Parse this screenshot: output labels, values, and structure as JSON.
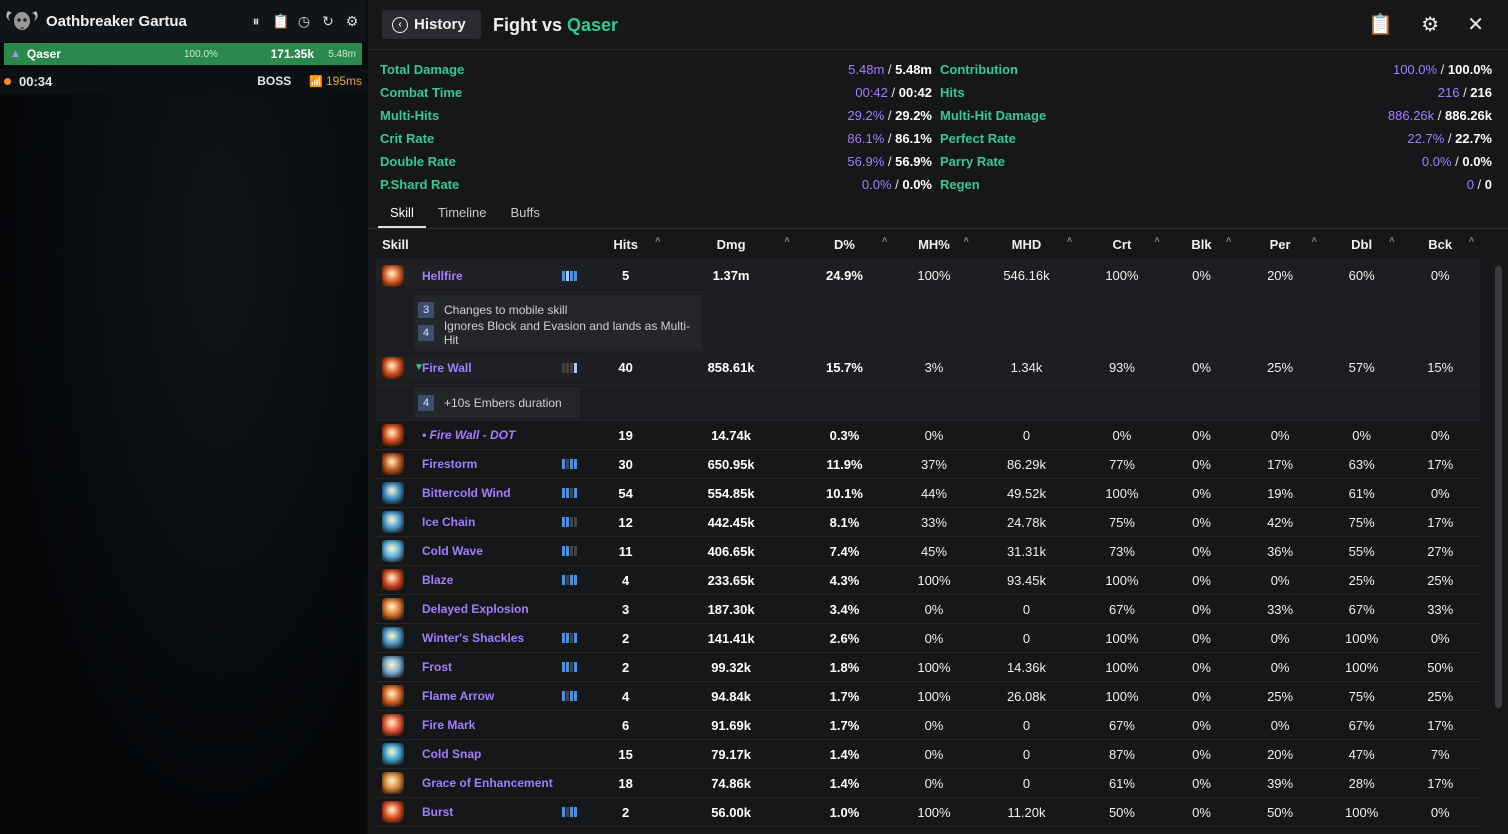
{
  "overlay": {
    "title": "Oathbreaker Gartua",
    "player": {
      "name": "Qaser",
      "pct": "100.0%",
      "damage": "171.35k",
      "total": "5.48m"
    },
    "timer": "00:34",
    "boss_label": "BOSS",
    "ping": "195ms"
  },
  "header": {
    "history_label": "History",
    "fight_prefix": "Fight vs ",
    "opponent": "Qaser"
  },
  "stats": [
    {
      "l_label": "Total Damage",
      "l_a": "5.48m",
      "l_b": "5.48m",
      "r_label": "Contribution",
      "r_a": "100.0%",
      "r_b": "100.0%"
    },
    {
      "l_label": "Combat Time",
      "l_a": "00:42",
      "l_b": "00:42",
      "r_label": "Hits",
      "r_a": "216",
      "r_b": "216"
    },
    {
      "l_label": "Multi-Hits",
      "l_a": "29.2%",
      "l_b": "29.2%",
      "r_label": "Multi-Hit Damage",
      "r_a": "886.26k",
      "r_b": "886.26k"
    },
    {
      "l_label": "Crit Rate",
      "l_a": "86.1%",
      "l_b": "86.1%",
      "r_label": "Perfect Rate",
      "r_a": "22.7%",
      "r_b": "22.7%"
    },
    {
      "l_label": "Double Rate",
      "l_a": "56.9%",
      "l_b": "56.9%",
      "r_label": "Parry Rate",
      "r_a": "0.0%",
      "r_b": "0.0%"
    },
    {
      "l_label": "P.Shard Rate",
      "l_a": "0.0%",
      "l_b": "0.0%",
      "r_label": "Regen",
      "r_a": "0",
      "r_b": "0"
    }
  ],
  "tabs": [
    "Skill",
    "Timeline",
    "Buffs"
  ],
  "columns": [
    "Skill",
    "Hits",
    "Dmg",
    "D%",
    "MH%",
    "MHD",
    "Crt",
    "Blk",
    "Per",
    "Dbl",
    "Bck"
  ],
  "rows": [
    {
      "name": "Hellfire",
      "hits": "5",
      "dmg": "1.37m",
      "dp": "24.9%",
      "mhp": "100%",
      "mhd": "546.16k",
      "crt": "100%",
      "blk": "0%",
      "per": "20%",
      "dbl": "60%",
      "bck": "0%",
      "bars": [
        1,
        2,
        1,
        1
      ],
      "color": "#e0602a",
      "traits": [
        {
          "n": "3",
          "text": "Changes to mobile skill"
        },
        {
          "n": "4",
          "text": "Ignores Block and Evasion and lands as Multi-Hit"
        }
      ]
    },
    {
      "name": "Fire Wall",
      "hits": "40",
      "dmg": "858.61k",
      "dp": "15.7%",
      "mhp": "3%",
      "mhd": "1.34k",
      "crt": "93%",
      "blk": "0%",
      "per": "25%",
      "dbl": "57%",
      "bck": "15%",
      "bars": [
        0,
        0,
        0,
        2
      ],
      "color": "#d8501e",
      "expanded": true,
      "traits": [
        {
          "n": "4",
          "text": "+10s Embers duration"
        }
      ]
    },
    {
      "name": "• Fire Wall - DOT",
      "sub": true,
      "hits": "19",
      "dmg": "14.74k",
      "dp": "0.3%",
      "mhp": "0%",
      "mhd": "0",
      "crt": "0%",
      "blk": "0%",
      "per": "0%",
      "dbl": "0%",
      "bck": "0%",
      "bars": [],
      "color": "#d8501e"
    },
    {
      "name": "Firestorm",
      "hits": "30",
      "dmg": "650.95k",
      "dp": "11.9%",
      "mhp": "37%",
      "mhd": "86.29k",
      "crt": "77%",
      "blk": "0%",
      "per": "17%",
      "dbl": "63%",
      "bck": "17%",
      "bars": [
        1,
        0,
        1,
        1
      ],
      "color": "#c45a22"
    },
    {
      "name": "Bittercold Wind",
      "hits": "54",
      "dmg": "554.85k",
      "dp": "10.1%",
      "mhp": "44%",
      "mhd": "49.52k",
      "crt": "100%",
      "blk": "0%",
      "per": "19%",
      "dbl": "61%",
      "bck": "0%",
      "bars": [
        1,
        1,
        0,
        1
      ],
      "color": "#3a8fc8"
    },
    {
      "name": "Ice Chain",
      "hits": "12",
      "dmg": "442.45k",
      "dp": "8.1%",
      "mhp": "33%",
      "mhd": "24.78k",
      "crt": "75%",
      "blk": "0%",
      "per": "42%",
      "dbl": "75%",
      "bck": "17%",
      "bars": [
        1,
        1,
        0,
        0
      ],
      "color": "#4aa0d8"
    },
    {
      "name": "Cold Wave",
      "hits": "11",
      "dmg": "406.65k",
      "dp": "7.4%",
      "mhp": "45%",
      "mhd": "31.31k",
      "crt": "73%",
      "blk": "0%",
      "per": "36%",
      "dbl": "55%",
      "bck": "27%",
      "bars": [
        1,
        1,
        0,
        0
      ],
      "color": "#5ab4e0"
    },
    {
      "name": "Blaze",
      "hits": "4",
      "dmg": "233.65k",
      "dp": "4.3%",
      "mhp": "100%",
      "mhd": "93.45k",
      "crt": "100%",
      "blk": "0%",
      "per": "0%",
      "dbl": "25%",
      "bck": "25%",
      "bars": [
        1,
        0,
        1,
        1
      ],
      "color": "#d44a26"
    },
    {
      "name": "Delayed Explosion",
      "hits": "3",
      "dmg": "187.30k",
      "dp": "3.4%",
      "mhp": "0%",
      "mhd": "0",
      "crt": "67%",
      "blk": "0%",
      "per": "33%",
      "dbl": "67%",
      "bck": "33%",
      "bars": [],
      "color": "#e07a30"
    },
    {
      "name": "Winter's Shackles",
      "hits": "2",
      "dmg": "141.41k",
      "dp": "2.6%",
      "mhp": "0%",
      "mhd": "0",
      "crt": "100%",
      "blk": "0%",
      "per": "0%",
      "dbl": "100%",
      "bck": "0%",
      "bars": [
        1,
        1,
        0,
        1
      ],
      "color": "#4a98c8"
    },
    {
      "name": "Frost",
      "hits": "2",
      "dmg": "99.32k",
      "dp": "1.8%",
      "mhp": "100%",
      "mhd": "14.36k",
      "crt": "100%",
      "blk": "0%",
      "per": "0%",
      "dbl": "100%",
      "bck": "50%",
      "bars": [
        1,
        1,
        0,
        1
      ],
      "color": "#7ab0d8"
    },
    {
      "name": "Flame Arrow",
      "hits": "4",
      "dmg": "94.84k",
      "dp": "1.7%",
      "mhp": "100%",
      "mhd": "26.08k",
      "crt": "100%",
      "blk": "0%",
      "per": "25%",
      "dbl": "75%",
      "bck": "25%",
      "bars": [
        1,
        0,
        1,
        1
      ],
      "color": "#e0682a"
    },
    {
      "name": "Fire Mark",
      "hits": "6",
      "dmg": "91.69k",
      "dp": "1.7%",
      "mhp": "0%",
      "mhd": "0",
      "crt": "67%",
      "blk": "0%",
      "per": "0%",
      "dbl": "67%",
      "bck": "17%",
      "bars": [],
      "color": "#e85a3a"
    },
    {
      "name": "Cold Snap",
      "hits": "15",
      "dmg": "79.17k",
      "dp": "1.4%",
      "mhp": "0%",
      "mhd": "0",
      "crt": "87%",
      "blk": "0%",
      "per": "20%",
      "dbl": "47%",
      "bck": "7%",
      "bars": [],
      "color": "#38a8d8"
    },
    {
      "name": "Grace of Enhancement",
      "hits": "18",
      "dmg": "74.86k",
      "dp": "1.4%",
      "mhp": "0%",
      "mhd": "0",
      "crt": "61%",
      "blk": "0%",
      "per": "39%",
      "dbl": "28%",
      "bck": "17%",
      "bars": [],
      "color": "#d88a3a"
    },
    {
      "name": "Burst",
      "hits": "2",
      "dmg": "56.00k",
      "dp": "1.0%",
      "mhp": "100%",
      "mhd": "11.20k",
      "crt": "50%",
      "blk": "0%",
      "per": "50%",
      "dbl": "100%",
      "bck": "0%",
      "bars": [
        1,
        0,
        1,
        1
      ],
      "color": "#e0502a"
    }
  ]
}
